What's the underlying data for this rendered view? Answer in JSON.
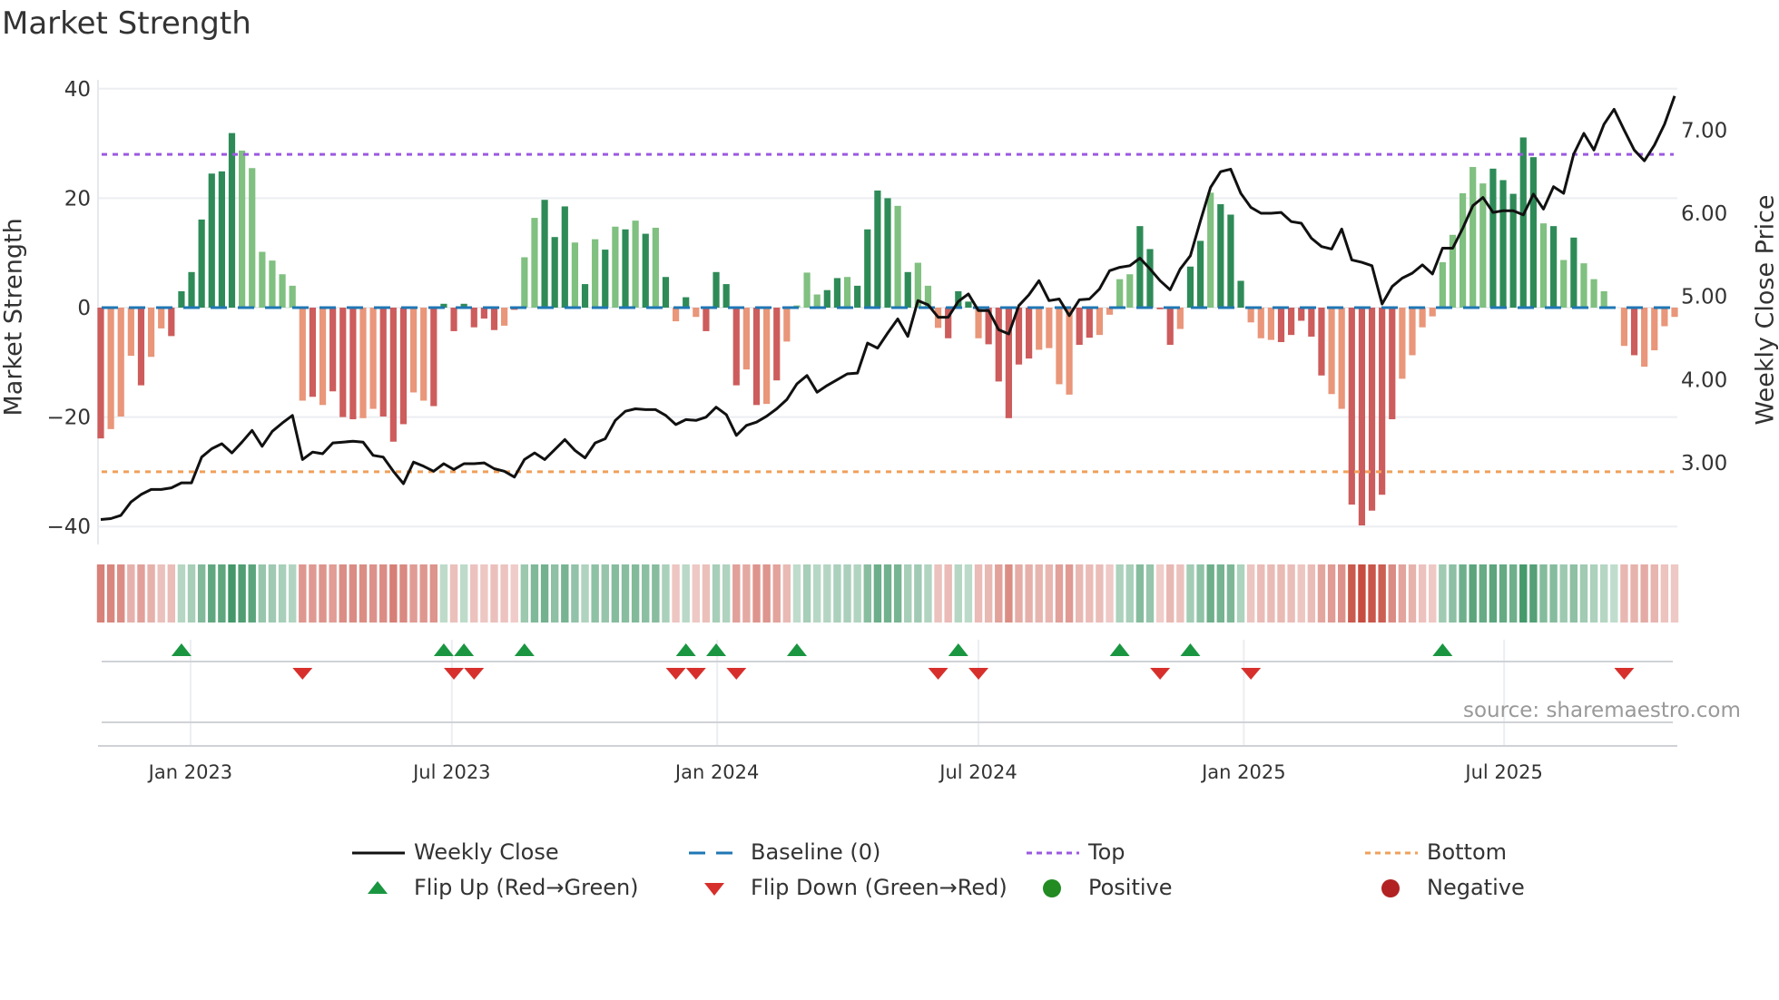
{
  "chart_data": {
    "type": "bar",
    "title": "Market Strength",
    "ylabel": "Market Strength",
    "y2label": "Weekly Close Price",
    "ylim": [
      -40,
      40
    ],
    "y2lim": [
      2.23,
      7.49
    ],
    "yticks": [
      {
        "v": 40,
        "label": "40"
      },
      {
        "v": 20,
        "label": "20"
      },
      {
        "v": 0,
        "label": "0"
      },
      {
        "v": -20,
        "label": "−20"
      },
      {
        "v": -40,
        "label": "−40"
      }
    ],
    "y2ticks": [
      {
        "v": 7,
        "label": "7.00"
      },
      {
        "v": 6,
        "label": "6.00"
      },
      {
        "v": 5,
        "label": "5.00"
      },
      {
        "v": 4,
        "label": "4.00"
      },
      {
        "v": 3,
        "label": "3.00"
      }
    ],
    "xticks": [
      {
        "week": 8.9,
        "label": "Jan 2023"
      },
      {
        "week": 34.8,
        "label": "Jul 2023"
      },
      {
        "week": 61.1,
        "label": "Jan 2024"
      },
      {
        "week": 87.0,
        "label": "Jul 2024"
      },
      {
        "week": 113.3,
        "label": "Jan 2025"
      },
      {
        "week": 139.1,
        "label": "Jul 2025"
      }
    ],
    "top_level": 28,
    "bottom_level": -30,
    "baseline": 0,
    "strength": [
      -23.9,
      -22.2,
      -19.9,
      -8.8,
      -14.2,
      -9,
      -3.8,
      -5.2,
      3,
      6.5,
      16.1,
      24.5,
      24.9,
      31.9,
      28.7,
      25.5,
      10.2,
      8.6,
      6.1,
      4,
      -17,
      -16.3,
      -17.8,
      -15.3,
      -20,
      -20.4,
      -20.2,
      -18.5,
      -19.9,
      -24.5,
      -21.3,
      -15.5,
      -17,
      -18,
      0.7,
      -4.3,
      0.7,
      -3.6,
      -2,
      -4.1,
      -3.3,
      -0.4,
      9.2,
      16.4,
      19.7,
      12.9,
      18.5,
      11.9,
      4.3,
      12.5,
      10.6,
      14.8,
      14.3,
      15.9,
      13.5,
      14.6,
      5.6,
      -2.5,
      1.9,
      -1.7,
      -4.3,
      6.5,
      4.3,
      -14.2,
      -11.3,
      -17.8,
      -17.6,
      -13.3,
      -6.2,
      0.4,
      6.4,
      2.4,
      3.2,
      5.4,
      5.6,
      4,
      14.3,
      21.4,
      20,
      18.6,
      6.5,
      8.2,
      4,
      -3.7,
      -5.6,
      3,
      1.1,
      -5.6,
      -6.7,
      -13.5,
      -20.2,
      -10.4,
      -9.3,
      -7.7,
      -7.4,
      -14,
      -15.9,
      -6.8,
      -5.5,
      -5,
      -1.3,
      5.2,
      6.1,
      14.9,
      10.7,
      -0.3,
      -6.8,
      -3.9,
      7.5,
      12.2,
      21,
      18.9,
      17,
      4.9,
      -2.7,
      -5.6,
      -5.9,
      -6.3,
      -5,
      -2.4,
      -5.3,
      -12.4,
      -15.8,
      -18.5,
      -36,
      -39.8,
      -37.1,
      -34.2,
      -20.4,
      -13,
      -8.7,
      -3.6,
      -1.6,
      8.3,
      13.3,
      20.9,
      25.7,
      22.7,
      25.4,
      23.3,
      20.8,
      31.1,
      27.5,
      15.4,
      14.9,
      8.7,
      12.8,
      8.1,
      5.2,
      3,
      0,
      -7,
      -8.7,
      -10.8,
      -7.8,
      -3.4,
      -1.7
    ],
    "shade": "dllldlldddddddllllllldldddlldddlldddddddldlldddldldldldldldlddddldldllllddlddddldllldddldddddllllddllllddddlddldddllldddddlldddddllllllllldddddldldllllldllllldddlll",
    "weekly_close": [
      2.32,
      2.33,
      2.37,
      2.53,
      2.62,
      2.68,
      2.68,
      2.7,
      2.76,
      2.76,
      3.07,
      3.17,
      3.23,
      3.12,
      3.25,
      3.39,
      3.2,
      3.38,
      3.48,
      3.57,
      3.04,
      3.13,
      3.11,
      3.24,
      3.25,
      3.26,
      3.25,
      3.09,
      3.07,
      2.9,
      2.75,
      3.01,
      2.96,
      2.9,
      2.99,
      2.92,
      2.99,
      2.99,
      3.0,
      2.93,
      2.9,
      2.83,
      3.04,
      3.12,
      3.04,
      3.16,
      3.28,
      3.15,
      3.06,
      3.24,
      3.29,
      3.51,
      3.62,
      3.65,
      3.64,
      3.64,
      3.57,
      3.46,
      3.52,
      3.51,
      3.55,
      3.67,
      3.58,
      3.33,
      3.45,
      3.49,
      3.56,
      3.65,
      3.76,
      3.95,
      4.05,
      3.85,
      3.93,
      4.0,
      4.07,
      4.08,
      4.44,
      4.38,
      4.56,
      4.73,
      4.52,
      4.95,
      4.9,
      4.75,
      4.75,
      4.94,
      5.03,
      4.83,
      4.83,
      4.6,
      4.55,
      4.89,
      5.02,
      5.19,
      4.95,
      4.97,
      4.77,
      4.96,
      4.97,
      5.09,
      5.31,
      5.35,
      5.37,
      5.46,
      5.33,
      5.19,
      5.08,
      5.33,
      5.49,
      5.91,
      6.31,
      6.5,
      6.53,
      6.24,
      6.07,
      6.0,
      6.0,
      6.01,
      5.9,
      5.88,
      5.7,
      5.6,
      5.57,
      5.81,
      5.44,
      5.41,
      5.37,
      4.91,
      5.12,
      5.22,
      5.28,
      5.38,
      5.27,
      5.58,
      5.58,
      5.82,
      6.09,
      6.19,
      6.01,
      6.03,
      6.03,
      5.98,
      6.23,
      6.05,
      6.32,
      6.24,
      6.71,
      6.96,
      6.76,
      7.07,
      7.25,
      7.0,
      6.76,
      6.63,
      6.82,
      7.07,
      7.41
    ],
    "legend": [
      {
        "key": "close",
        "label": "Weekly Close"
      },
      {
        "key": "baseline",
        "label": "Baseline (0)"
      },
      {
        "key": "top",
        "label": "Top"
      },
      {
        "key": "bottom",
        "label": "Bottom"
      },
      {
        "key": "flipup",
        "label": "Flip Up (Red→Green)"
      },
      {
        "key": "flipdown",
        "label": "Flip Down (Green→Red)"
      },
      {
        "key": "positive",
        "label": "Positive"
      },
      {
        "key": "negative",
        "label": "Negative"
      }
    ],
    "legend_placement": "bottom",
    "grid": true
  },
  "colors": {
    "pos_strong": "#2e8b57",
    "pos_weak": "#80c080",
    "neg_strong": "#cd5c5c",
    "neg_weak": "#e9967a",
    "close": "#111111",
    "baseline": "#1f77b4",
    "top": "#9b59e0",
    "bottom": "#f0a05a",
    "flipup": "#1a9641",
    "flipdown": "#d7302c",
    "positive": "#228b22",
    "negative": "#b22222"
  },
  "source": "source: sharemaestro.com"
}
